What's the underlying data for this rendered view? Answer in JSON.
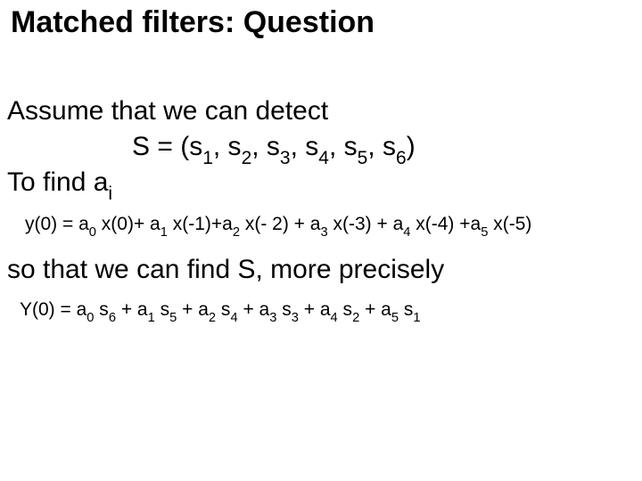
{
  "title": "Matched filters: Question",
  "assume_text": "Assume that we can detect",
  "s_def": {
    "prefix": "S = (s",
    "i1": "1",
    "sep": ", s",
    "i2": "2",
    "i3": "3",
    "i4": "4",
    "i5": "5",
    "sep5": ",",
    "sp": " s",
    "i6": "6",
    "suffix": ")"
  },
  "find": {
    "prefix": "To find a",
    "sub": "i"
  },
  "eq1": {
    "lhs": "y(0)  =  a",
    "a0s": "0",
    "t0": " x(0)+ a",
    "a1s": "1",
    "t1": " x(-1)+a",
    "a2s": "2",
    "t2": " x(- 2) + a",
    "a3s": "3",
    "t3": " x(-3)  + a",
    "a4s": "4",
    "t4": " x(-4)  +a",
    "a5s": "5",
    "t5": " x(-5)"
  },
  "so_text": "so that we can find S, more precisely",
  "eq2": {
    "lhs": "Y(0)  =  a",
    "a0s": "0",
    "t0": " s",
    "s6": "6",
    "p1": "   + a",
    "a1s": "1",
    "t1": " s",
    "s5": "5",
    "p2": "  + a",
    "a2s": "2",
    "t2": " s",
    "s4": "4",
    "p3": " + a",
    "a3s": "3",
    "t3": " s",
    "s3": "3",
    "p4": "  + a",
    "a4s": "4",
    "t4": " s",
    "s2": "2",
    "p5": "  + a",
    "a5s": "5",
    "t5": " s",
    "s1": "1"
  }
}
